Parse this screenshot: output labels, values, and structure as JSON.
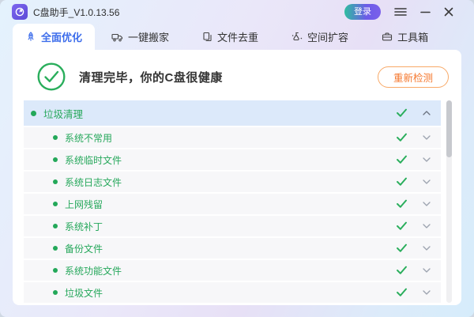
{
  "window": {
    "title": "C盘助手_V1.0.13.56"
  },
  "titlebar": {
    "login_label": "登录"
  },
  "tabs": [
    {
      "label": "全面优化",
      "active": true
    },
    {
      "label": "一键搬家",
      "active": false
    },
    {
      "label": "文件去重",
      "active": false
    },
    {
      "label": "空间扩容",
      "active": false
    },
    {
      "label": "工具箱",
      "active": false
    }
  ],
  "result": {
    "message": "清理完毕，你的C盘很健康",
    "recheck_label": "重新检测"
  },
  "cleanup": {
    "group": {
      "label": "垃圾清理",
      "status": "done",
      "expanded": true
    },
    "items": [
      {
        "label": "系统不常用",
        "status": "done"
      },
      {
        "label": "系统临时文件",
        "status": "done"
      },
      {
        "label": "系统日志文件",
        "status": "done"
      },
      {
        "label": "上网残留",
        "status": "done"
      },
      {
        "label": "系统补丁",
        "status": "done"
      },
      {
        "label": "备份文件",
        "status": "done"
      },
      {
        "label": "系统功能文件",
        "status": "done"
      },
      {
        "label": "垃圾文件",
        "status": "done"
      }
    ]
  },
  "colors": {
    "accent_blue": "#3d6deb",
    "success_green": "#2aae5c",
    "warning_orange": "#f5772d",
    "header_row_bg": "#dce9fa",
    "login_gradient_start": "#2fbe9f",
    "login_gradient_end": "#6c5be8"
  }
}
